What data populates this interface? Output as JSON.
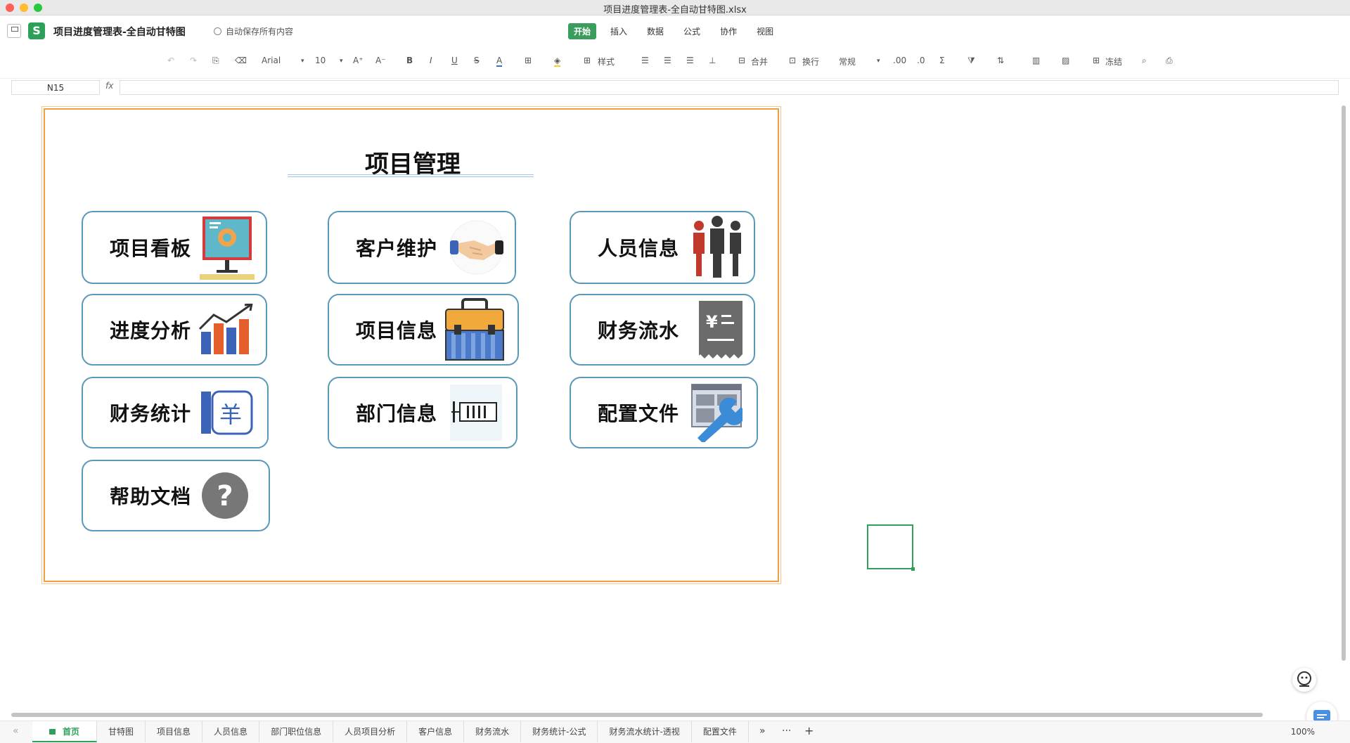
{
  "window": {
    "title": "项目进度管理表-全自动甘特图.xlsx"
  },
  "app": {
    "doc_name": "项目进度管理表-全自动甘特图",
    "autosave": "自动保存所有内容",
    "menu": [
      "开始",
      "插入",
      "数据",
      "公式",
      "协作",
      "视图"
    ],
    "active_menu": "开始"
  },
  "toolbar": {
    "font": "Arial",
    "font_size": "10",
    "style_label": "样式",
    "merge_label": "合并",
    "wrap_label": "换行",
    "number_format": "常规",
    "freeze_label": "冻结",
    "bold": "B",
    "italic": "I",
    "underline": "U",
    "strike": "S",
    "font_color": "A",
    "sum": "Σ"
  },
  "formula_bar": {
    "cell_ref": "N15",
    "fx": "fx",
    "value": ""
  },
  "dashboard": {
    "title": "项目管理",
    "cards": [
      {
        "label": "项目看板",
        "icon": "monitor-chart-icon"
      },
      {
        "label": "客户维护",
        "icon": "handshake-icon"
      },
      {
        "label": "人员信息",
        "icon": "people-icon"
      },
      {
        "label": "进度分析",
        "icon": "bar-growth-chart-icon"
      },
      {
        "label": "项目信息",
        "icon": "toolbox-icon"
      },
      {
        "label": "财务流水",
        "icon": "receipt-icon"
      },
      {
        "label": "财务统计",
        "icon": "finance-book-icon"
      },
      {
        "label": "部门信息",
        "icon": "barcode-scanner-icon"
      },
      {
        "label": "配置文件",
        "icon": "settings-wrench-icon"
      },
      {
        "label": "帮助文档",
        "icon": "question-icon"
      }
    ]
  },
  "sheet_tabs": [
    "首页",
    "甘特图",
    "项目信息",
    "人员信息",
    "部门职位信息",
    "人员项目分析",
    "客户信息",
    "财务流水",
    "财务统计-公式",
    "财务流水统计-透视",
    "配置文件"
  ],
  "active_sheet": "首页",
  "tab_extra": {
    "more": "»",
    "ellipsis": "···",
    "add": "+"
  },
  "status": {
    "zoom": "100%"
  },
  "colors": {
    "accent_green": "#2ea05a",
    "panel_border": "#f0a040",
    "card_border": "#5a9ab8"
  }
}
